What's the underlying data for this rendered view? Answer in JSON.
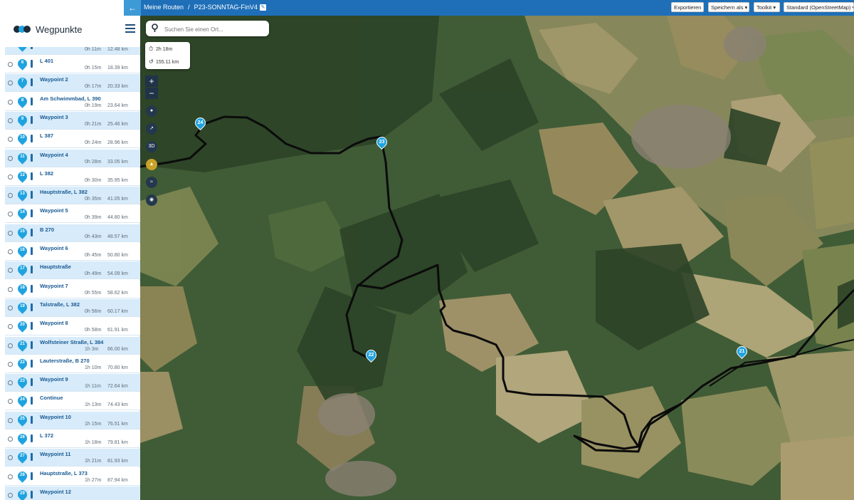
{
  "topbar": {
    "back_icon": "arrow-left-icon",
    "breadcrumb_root": "Meine Routen",
    "breadcrumb_sep": "/",
    "route_name": "P23-SONNTAG-FinV4",
    "buttons": {
      "export": "Exportieren",
      "save_as": "Speichern als ▾",
      "toolkit": "Toolkit ▾",
      "map_style": "Standard (OpenStreetMap) ▾"
    }
  },
  "sidebar": {
    "title": "Wegpunkte",
    "first_row": {
      "time": "0h 11m",
      "dist": "12.48 km"
    },
    "items": [
      {
        "num": "6",
        "label": "L 401",
        "time": "0h 15m",
        "dist": "18.39 km"
      },
      {
        "num": "7",
        "label": "Waypoint 2",
        "time": "0h 17m",
        "dist": "20.33 km"
      },
      {
        "num": "8",
        "label": "Am Schwimmbad, L 390",
        "time": "0h 19m",
        "dist": "23.64 km"
      },
      {
        "num": "9",
        "label": "Waypoint 3",
        "time": "0h 21m",
        "dist": "25.46 km"
      },
      {
        "num": "10",
        "label": "L 387",
        "time": "0h 24m",
        "dist": "28.96 km"
      },
      {
        "num": "11",
        "label": "Waypoint 4",
        "time": "0h 28m",
        "dist": "33.05 km"
      },
      {
        "num": "12",
        "label": "L 382",
        "time": "0h 30m",
        "dist": "35.95 km"
      },
      {
        "num": "13",
        "label": "Hauptstraße, L 382",
        "time": "0h 35m",
        "dist": "41.05 km"
      },
      {
        "num": "14",
        "label": "Waypoint 5",
        "time": "0h 39m",
        "dist": "44.80 km"
      },
      {
        "num": "15",
        "label": "B 270",
        "time": "0h 43m",
        "dist": "48.57 km"
      },
      {
        "num": "16",
        "label": "Waypoint 6",
        "time": "0h 45m",
        "dist": "50.80 km"
      },
      {
        "num": "17",
        "label": "Hauptstraße",
        "time": "0h 49m",
        "dist": "54.09 km"
      },
      {
        "num": "18",
        "label": "Waypoint 7",
        "time": "0h 55m",
        "dist": "58.62 km"
      },
      {
        "num": "19",
        "label": "Talstraße, L 382",
        "time": "0h 56m",
        "dist": "60.17 km"
      },
      {
        "num": "20",
        "label": "Waypoint 8",
        "time": "0h 58m",
        "dist": "61.91 km"
      },
      {
        "num": "21",
        "label": "Wolfsteiner Straße, L 384",
        "time": "1h 3m",
        "dist": "66.00 km"
      },
      {
        "num": "22",
        "label": "Lauterstraße, B 270",
        "time": "1h 10m",
        "dist": "70.80 km"
      },
      {
        "num": "23",
        "label": "Waypoint 9",
        "time": "1h 11m",
        "dist": "72.64 km"
      },
      {
        "num": "24",
        "label": "Continue",
        "time": "1h 13m",
        "dist": "74.43 km"
      },
      {
        "num": "25",
        "label": "Waypoint 10",
        "time": "1h 15m",
        "dist": "76.51 km"
      },
      {
        "num": "26",
        "label": "L 372",
        "time": "1h 18m",
        "dist": "79.81 km"
      },
      {
        "num": "27",
        "label": "Waypoint 11",
        "time": "1h 21m",
        "dist": "81.93 km"
      },
      {
        "num": "28",
        "label": "Hauptstraße, L 373",
        "time": "1h 27m",
        "dist": "87.94 km"
      },
      {
        "num": "29",
        "label": "Waypoint 12",
        "time": "",
        "dist": ""
      }
    ]
  },
  "map": {
    "search_placeholder": "Suchen Sie einen Ort...",
    "stats": {
      "duration": "2h 18m",
      "distance": "155.11 km"
    },
    "zoom_in": "+",
    "zoom_out": "−",
    "tool_3d": "3D",
    "markers": [
      "24",
      "23",
      "22",
      "21"
    ]
  },
  "colors": {
    "topbar": "#1e6fb8",
    "accent": "#1fa3e0",
    "row_alt": "#d7ebfa",
    "route": "#000000"
  }
}
